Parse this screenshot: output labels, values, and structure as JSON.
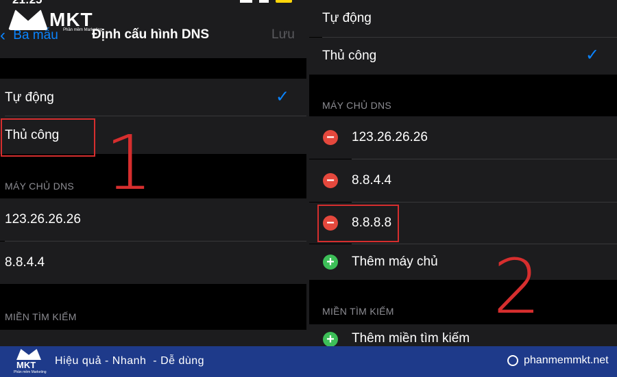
{
  "left": {
    "status_time": "21:25",
    "nav": {
      "back_label": "Ba mẫu",
      "title": "Định cấu hình DNS",
      "save_label": "Lưu"
    },
    "mode_options": [
      {
        "label": "Tự động",
        "checked": true
      },
      {
        "label": "Thủ công",
        "checked": false
      }
    ],
    "dns_section_label": "MÁY CHỦ DNS",
    "dns_servers": [
      "123.26.26.26",
      "8.8.4.4"
    ],
    "search_section_label": "MIỀN TÌM KIẾM",
    "annotation_number": "1"
  },
  "right": {
    "mode_options": [
      {
        "label": "Tự động",
        "checked": false
      },
      {
        "label": "Thủ công",
        "checked": true
      }
    ],
    "dns_section_label": "MÁY CHỦ DNS",
    "dns_servers": [
      "123.26.26.26",
      "8.8.4.4",
      "8.8.8.8"
    ],
    "add_server_label": "Thêm máy chủ",
    "search_section_label": "MIỀN TÌM KIẾM",
    "add_domain_label": "Thêm miền tìm kiếm",
    "annotation_number": "2"
  },
  "logo": {
    "text": "MKT",
    "tagline": "Phần mềm Marketing"
  },
  "footer": {
    "slogan": "Hiệu quả - Nhanh  - Dễ dùng",
    "website": "phanmemmkt.net",
    "logo_text": "MKT",
    "logo_tagline": "Phần mềm Marketing"
  },
  "colors": {
    "accent": "#0a84ff",
    "remove": "#e5483d",
    "add": "#3dbf58",
    "annotation": "#d62e2e",
    "footer_bg": "#1e3a8a"
  }
}
